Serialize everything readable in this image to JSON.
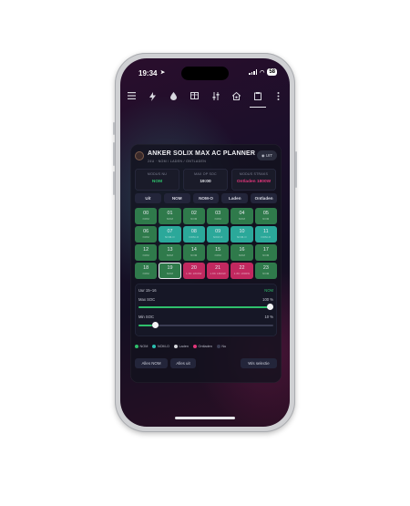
{
  "status_bar": {
    "time": "19:34",
    "battery": "58"
  },
  "toolbar": {
    "icons": [
      "menu-icon",
      "bolt-icon",
      "drop-icon",
      "table-icon",
      "sliders-icon",
      "home-gear-icon",
      "clipboard-icon",
      "more-icon"
    ]
  },
  "card": {
    "title": "ANKER SOLIX MAX AC PLANNER",
    "subtitle": "24U · NOM / LADEN / ONTLADEN",
    "uit_button": "UIT"
  },
  "info": [
    {
      "label": "MODUS NU",
      "value": "NOM",
      "color": "#2fbf6b"
    },
    {
      "label": "MAX OP SOC",
      "value": "19:00",
      "color": "#e6e8ee"
    },
    {
      "label": "MODUS STRAKS",
      "value": "Ontladen 1800W",
      "color": "#e0367a"
    }
  ],
  "modes": [
    "Uit",
    "NOM",
    "NOM-O",
    "Laden",
    "Ontladen"
  ],
  "hours": [
    {
      "h": "00",
      "m": "NOM",
      "t": "NOM"
    },
    {
      "h": "01",
      "m": "NOM",
      "t": "NOM"
    },
    {
      "h": "02",
      "m": "NOM",
      "t": "NOM"
    },
    {
      "h": "03",
      "m": "NOM",
      "t": "NOM"
    },
    {
      "h": "04",
      "m": "NOM",
      "t": "NOM"
    },
    {
      "h": "05",
      "m": "NOM",
      "t": "NOM"
    },
    {
      "h": "06",
      "m": "NOM",
      "t": "NOM"
    },
    {
      "h": "07",
      "m": "NOM-O",
      "t": "NOMO"
    },
    {
      "h": "08",
      "m": "NOM-O",
      "t": "NOMO"
    },
    {
      "h": "09",
      "m": "NOM-O",
      "t": "NOMO"
    },
    {
      "h": "10",
      "m": "NOM-O",
      "t": "NOMO"
    },
    {
      "h": "11",
      "m": "NOM-O",
      "t": "NOMO"
    },
    {
      "h": "12",
      "m": "NOM",
      "t": "NOM"
    },
    {
      "h": "13",
      "m": "NOM",
      "t": "NOM"
    },
    {
      "h": "14",
      "m": "NOM",
      "t": "NOM"
    },
    {
      "h": "15",
      "m": "NOM",
      "t": "NOM"
    },
    {
      "h": "16",
      "m": "NOM",
      "t": "NOM"
    },
    {
      "h": "17",
      "m": "NOM",
      "t": "NOM"
    },
    {
      "h": "18",
      "m": "NOM",
      "t": "NOM"
    },
    {
      "h": "19",
      "m": "NOM",
      "t": "NOM"
    },
    {
      "h": "20",
      "m": "1.8K 1800W",
      "t": "LADEN"
    },
    {
      "h": "21",
      "m": "1.8K 1800W",
      "t": "LADEN"
    },
    {
      "h": "22",
      "m": "1.8K 1800W",
      "t": "LADEN"
    },
    {
      "h": "23",
      "m": "NOM",
      "t": "NOM"
    }
  ],
  "sliders": {
    "range_label": "Uur 15–16",
    "range_mode": "NOM",
    "max_soc_label": "Max SOC",
    "max_soc_value": "100 %",
    "max_soc": 100,
    "min_soc_label": "Min SOC",
    "min_soc_value": "10 %",
    "min_soc": 10
  },
  "legend": [
    {
      "label": "NOM",
      "color": "#2fbf6b"
    },
    {
      "label": "NOM-O",
      "color": "#2bc0b0"
    },
    {
      "label": "Laden",
      "color": "#d7d8de"
    },
    {
      "label": "Ontladen",
      "color": "#e0367a"
    },
    {
      "label": "Nu",
      "color": "#3a3c52"
    }
  ],
  "actions": {
    "all_nom": "Alles NOM",
    "all_off": "Alles uit",
    "clear_selection": "Wis selectie"
  }
}
